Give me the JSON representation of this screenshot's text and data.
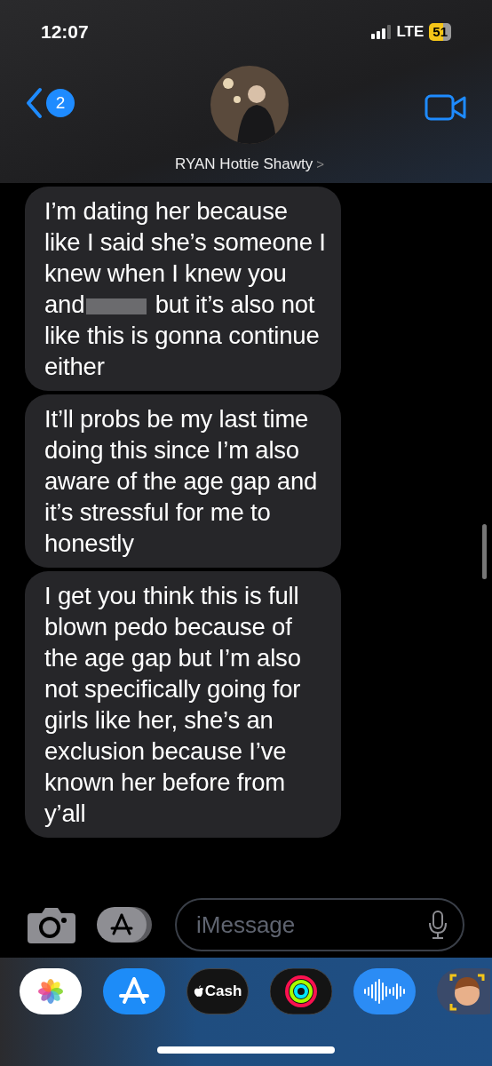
{
  "status_bar": {
    "time": "12:07",
    "network": "LTE",
    "battery": "51"
  },
  "header": {
    "back_badge": "2",
    "contact_name": "RYAN Hottie Shawty",
    "chevron": ">"
  },
  "messages": [
    {
      "kind": "redacted",
      "text_before": "I’m dating her because like I said she’s someone I knew when I knew you and",
      "text_after": "but it’s also not like this is gonna continue either"
    },
    {
      "kind": "plain",
      "text": "It’ll probs be my last time doing this since I’m also aware of the age gap and it’s stressful for me to honestly"
    },
    {
      "kind": "plain",
      "text": "I get you think this is full blown pedo because of the age gap but I’m also not specifically going for girls like her, she’s an exclusion because I’ve known her before from y’all"
    }
  ],
  "composer": {
    "placeholder": "iMessage"
  },
  "app_drawer": {
    "cash_label": "Cash"
  }
}
